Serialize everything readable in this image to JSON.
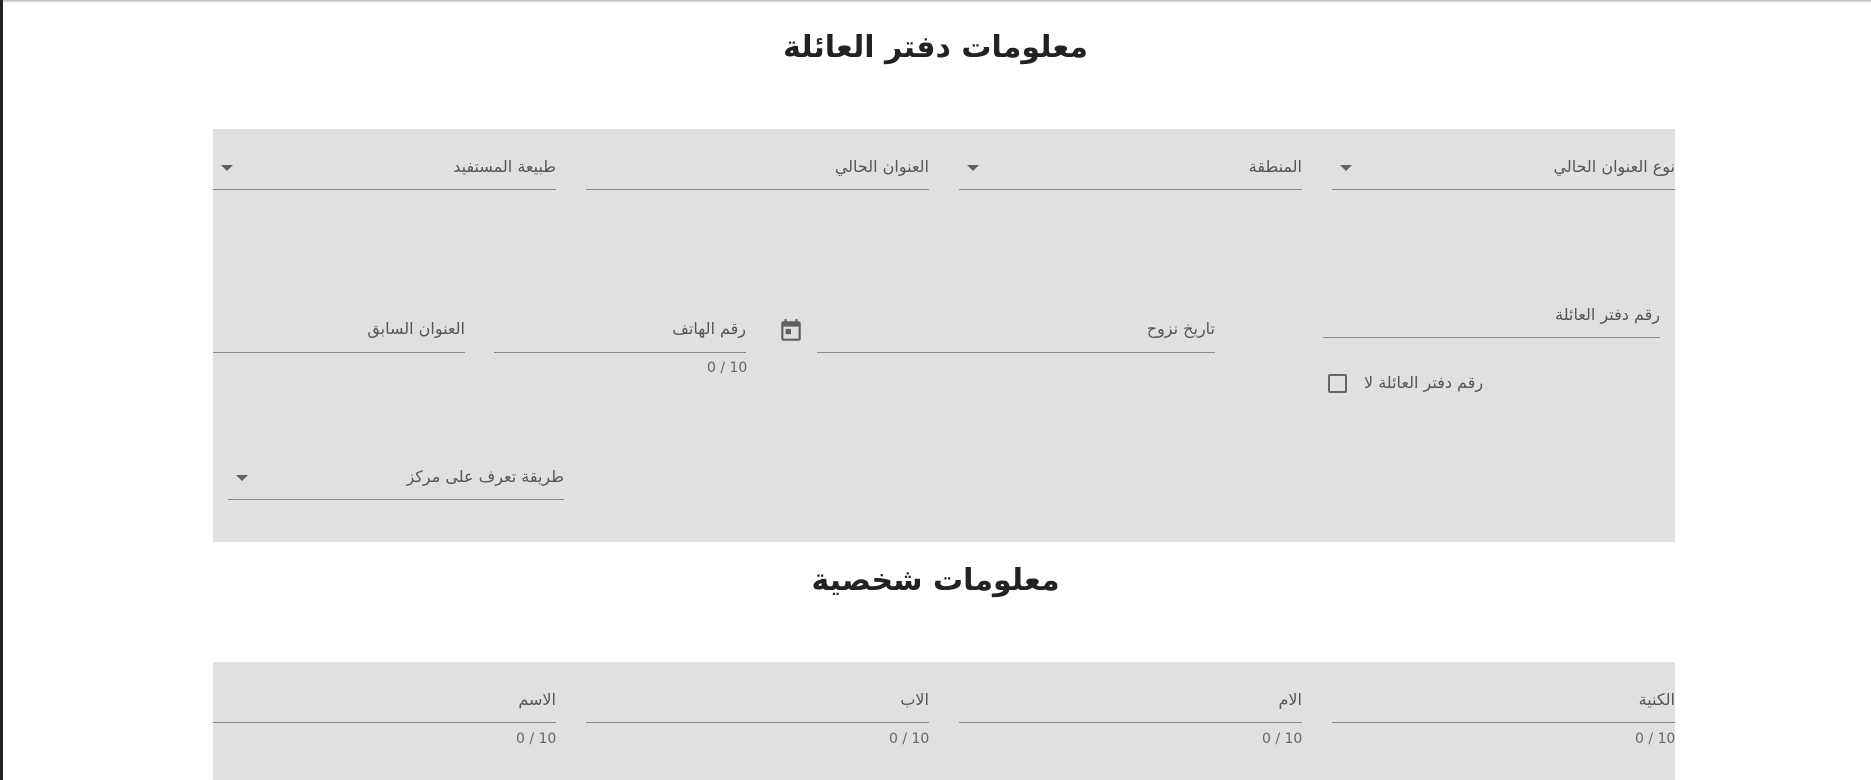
{
  "family_book_section": {
    "title": "معلومات دفتر العائلة",
    "fields": {
      "current_address_type": "نوع العنوان الحالي",
      "region": "المنطقة",
      "current_address": "العنوان الحالي",
      "beneficiary_nature": "طبيعة المستفيد",
      "family_book_number": "رقم دفتر العائلة",
      "no_family_book_checkbox": "رقم دفتر العائلة لا",
      "marriage_date": "تاريخ نزوح",
      "phone_number": "رقم الهاتف",
      "phone_counter": "0 / 10",
      "previous_address": "العنوان السابق",
      "discovery_method": "طريقة تعرف على مركز"
    },
    "icons": {
      "calendar": "calendar-icon",
      "dropdown": "chevron-down-icon"
    }
  },
  "personal_section": {
    "title": "معلومات شخصية",
    "fields": {
      "surname": "الكنية",
      "mother": "الام",
      "father": "الاب",
      "name": "الاسم"
    },
    "counters": {
      "surname": "0 / 10",
      "mother": "0 / 10",
      "father": "0 / 10",
      "name": "0 / 10"
    }
  }
}
